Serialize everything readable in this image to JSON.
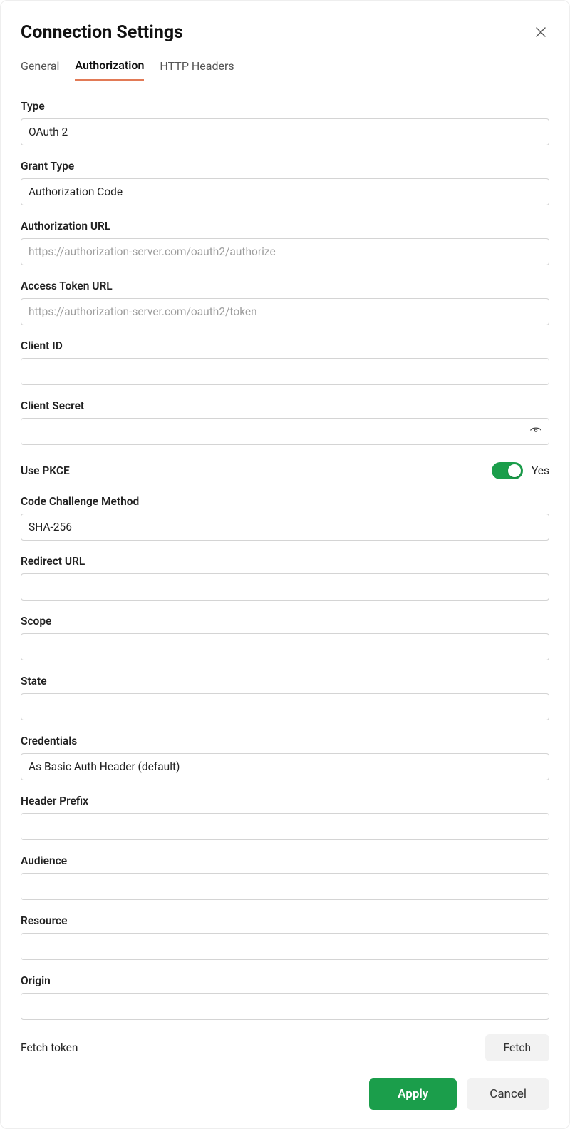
{
  "dialog": {
    "title": "Connection Settings",
    "tabs": {
      "general": "General",
      "authorization": "Authorization",
      "http_headers": "HTTP Headers"
    },
    "active_tab": "authorization"
  },
  "fields": {
    "type": {
      "label": "Type",
      "value": "OAuth 2"
    },
    "grant_type": {
      "label": "Grant Type",
      "value": "Authorization Code"
    },
    "authorization_url": {
      "label": "Authorization URL",
      "value": "",
      "placeholder": "https://authorization-server.com/oauth2/authorize"
    },
    "access_token_url": {
      "label": "Access Token URL",
      "value": "",
      "placeholder": "https://authorization-server.com/oauth2/token"
    },
    "client_id": {
      "label": "Client ID",
      "value": ""
    },
    "client_secret": {
      "label": "Client Secret",
      "value": ""
    },
    "use_pkce": {
      "label": "Use PKCE",
      "value_text": "Yes",
      "enabled": true
    },
    "code_challenge_method": {
      "label": "Code Challenge Method",
      "value": "SHA-256"
    },
    "redirect_url": {
      "label": "Redirect URL",
      "value": ""
    },
    "scope": {
      "label": "Scope",
      "value": ""
    },
    "state": {
      "label": "State",
      "value": ""
    },
    "credentials": {
      "label": "Credentials",
      "value": "As Basic Auth Header (default)"
    },
    "header_prefix": {
      "label": "Header Prefix",
      "value": ""
    },
    "audience": {
      "label": "Audience",
      "value": ""
    },
    "resource": {
      "label": "Resource",
      "value": ""
    },
    "origin": {
      "label": "Origin",
      "value": ""
    }
  },
  "fetch": {
    "label": "Fetch token",
    "button": "Fetch"
  },
  "footer": {
    "apply": "Apply",
    "cancel": "Cancel"
  }
}
